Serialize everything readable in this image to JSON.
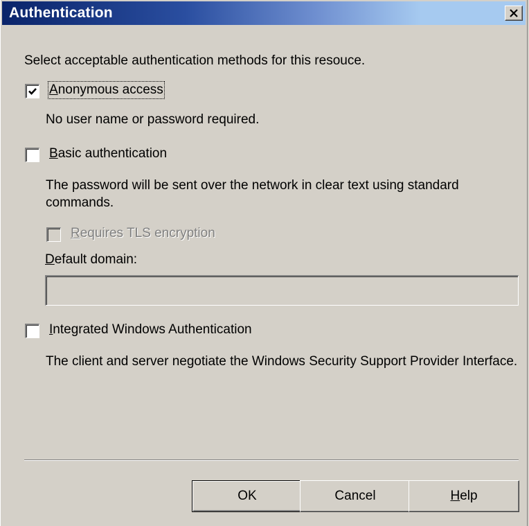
{
  "window": {
    "title": "Authentication",
    "close_glyph": "×"
  },
  "instructions": "Select acceptable authentication methods for this resouce.",
  "anonymous": {
    "checked": true,
    "label_mnemonic": "A",
    "label_rest": "nonymous access",
    "description": "No user name or password required."
  },
  "basic": {
    "checked": false,
    "label_mnemonic": "B",
    "label_rest": "asic authentication",
    "description": "The password will be sent over the network in clear text using standard commands."
  },
  "tls": {
    "checked": false,
    "enabled": false,
    "label_mnemonic": "R",
    "label_rest": "equires TLS encryption"
  },
  "domain": {
    "label_mnemonic": "D",
    "label_rest": "efault domain:",
    "value": ""
  },
  "integrated": {
    "checked": false,
    "label_mnemonic": "I",
    "label_rest": "ntegrated Windows Authentication",
    "description": "The client and server negotiate the Windows Security Support Provider Interface."
  },
  "buttons": {
    "ok": "OK",
    "cancel": "Cancel",
    "help_mnemonic": "H",
    "help_rest": "elp"
  },
  "colors": {
    "face": "#d4d0c8",
    "title_start": "#0a246a",
    "title_end": "#a6caf0"
  }
}
